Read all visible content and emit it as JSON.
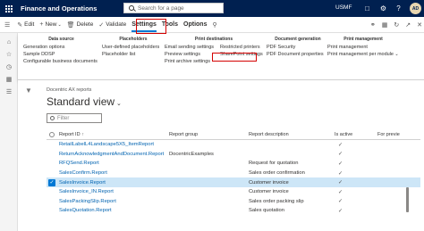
{
  "topbar": {
    "app_title": "Finance and Operations",
    "search_placeholder": "Search for a page",
    "company": "USMF",
    "avatar_initials": "AD",
    "icons": [
      "chat-icon",
      "gear-icon",
      "help-icon"
    ]
  },
  "actionbar": {
    "edit": "Edit",
    "new": "New",
    "delete": "Delete",
    "validate": "Validate",
    "tab_settings": "Settings",
    "tab_tools": "Tools",
    "tab_options": "Options"
  },
  "ribbon": {
    "data_source": {
      "title": "Data source",
      "items": [
        "Generation options",
        "Sample DDSP",
        "Configurable business documents"
      ]
    },
    "placeholders": {
      "title": "Placeholders",
      "items": [
        "User-defined placeholders",
        "Placeholder list"
      ]
    },
    "print_destinations": {
      "title": "Print destinations",
      "col1": [
        "Email sending settings",
        "Preview settings",
        "Print archive settings"
      ],
      "col2": [
        "Restricted printers",
        "SharePoint settings"
      ]
    },
    "document_generation": {
      "title": "Document generation",
      "items": [
        "PDF Security",
        "PDF Document properties"
      ]
    },
    "print_management": {
      "title": "Print management",
      "items": [
        "Print management",
        "Print management per module"
      ]
    }
  },
  "main": {
    "breadcrumb": "Docentric AX reports",
    "view_title": "Standard view",
    "filter_placeholder": "Filter"
  },
  "grid": {
    "headers": [
      "Report ID",
      "Report group",
      "Report description",
      "Is active",
      "For previe"
    ],
    "rows": [
      {
        "id": "RetailLabelL4Landscape5X5_ItemReport",
        "group": "",
        "description": "",
        "active": "✓",
        "preview": ""
      },
      {
        "id": "ReturnAcknowledgmentAndDocument.Report",
        "group": "DocentricExamples",
        "description": "",
        "active": "✓",
        "preview": ""
      },
      {
        "id": "RFQSend.Report",
        "group": "",
        "description": "Request for quotation",
        "active": "✓",
        "preview": ""
      },
      {
        "id": "SalesConfirm.Report",
        "group": "",
        "description": "Sales order confirmation",
        "active": "✓",
        "preview": ""
      },
      {
        "id": "SalesInvoice.Report",
        "group": "",
        "description": "Customer invoice",
        "active": "✓",
        "preview": ""
      },
      {
        "id": "SalesInvoice_IN.Report",
        "group": "",
        "description": "Customer invoice",
        "active": "✓",
        "preview": ""
      },
      {
        "id": "SalesPackingSlip.Report",
        "group": "",
        "description": "Sales order packing slip",
        "active": "✓",
        "preview": ""
      },
      {
        "id": "SalesQuotation.Report",
        "group": "",
        "description": "Sales quotation",
        "active": "✓",
        "preview": ""
      }
    ],
    "selected_index": 4
  }
}
